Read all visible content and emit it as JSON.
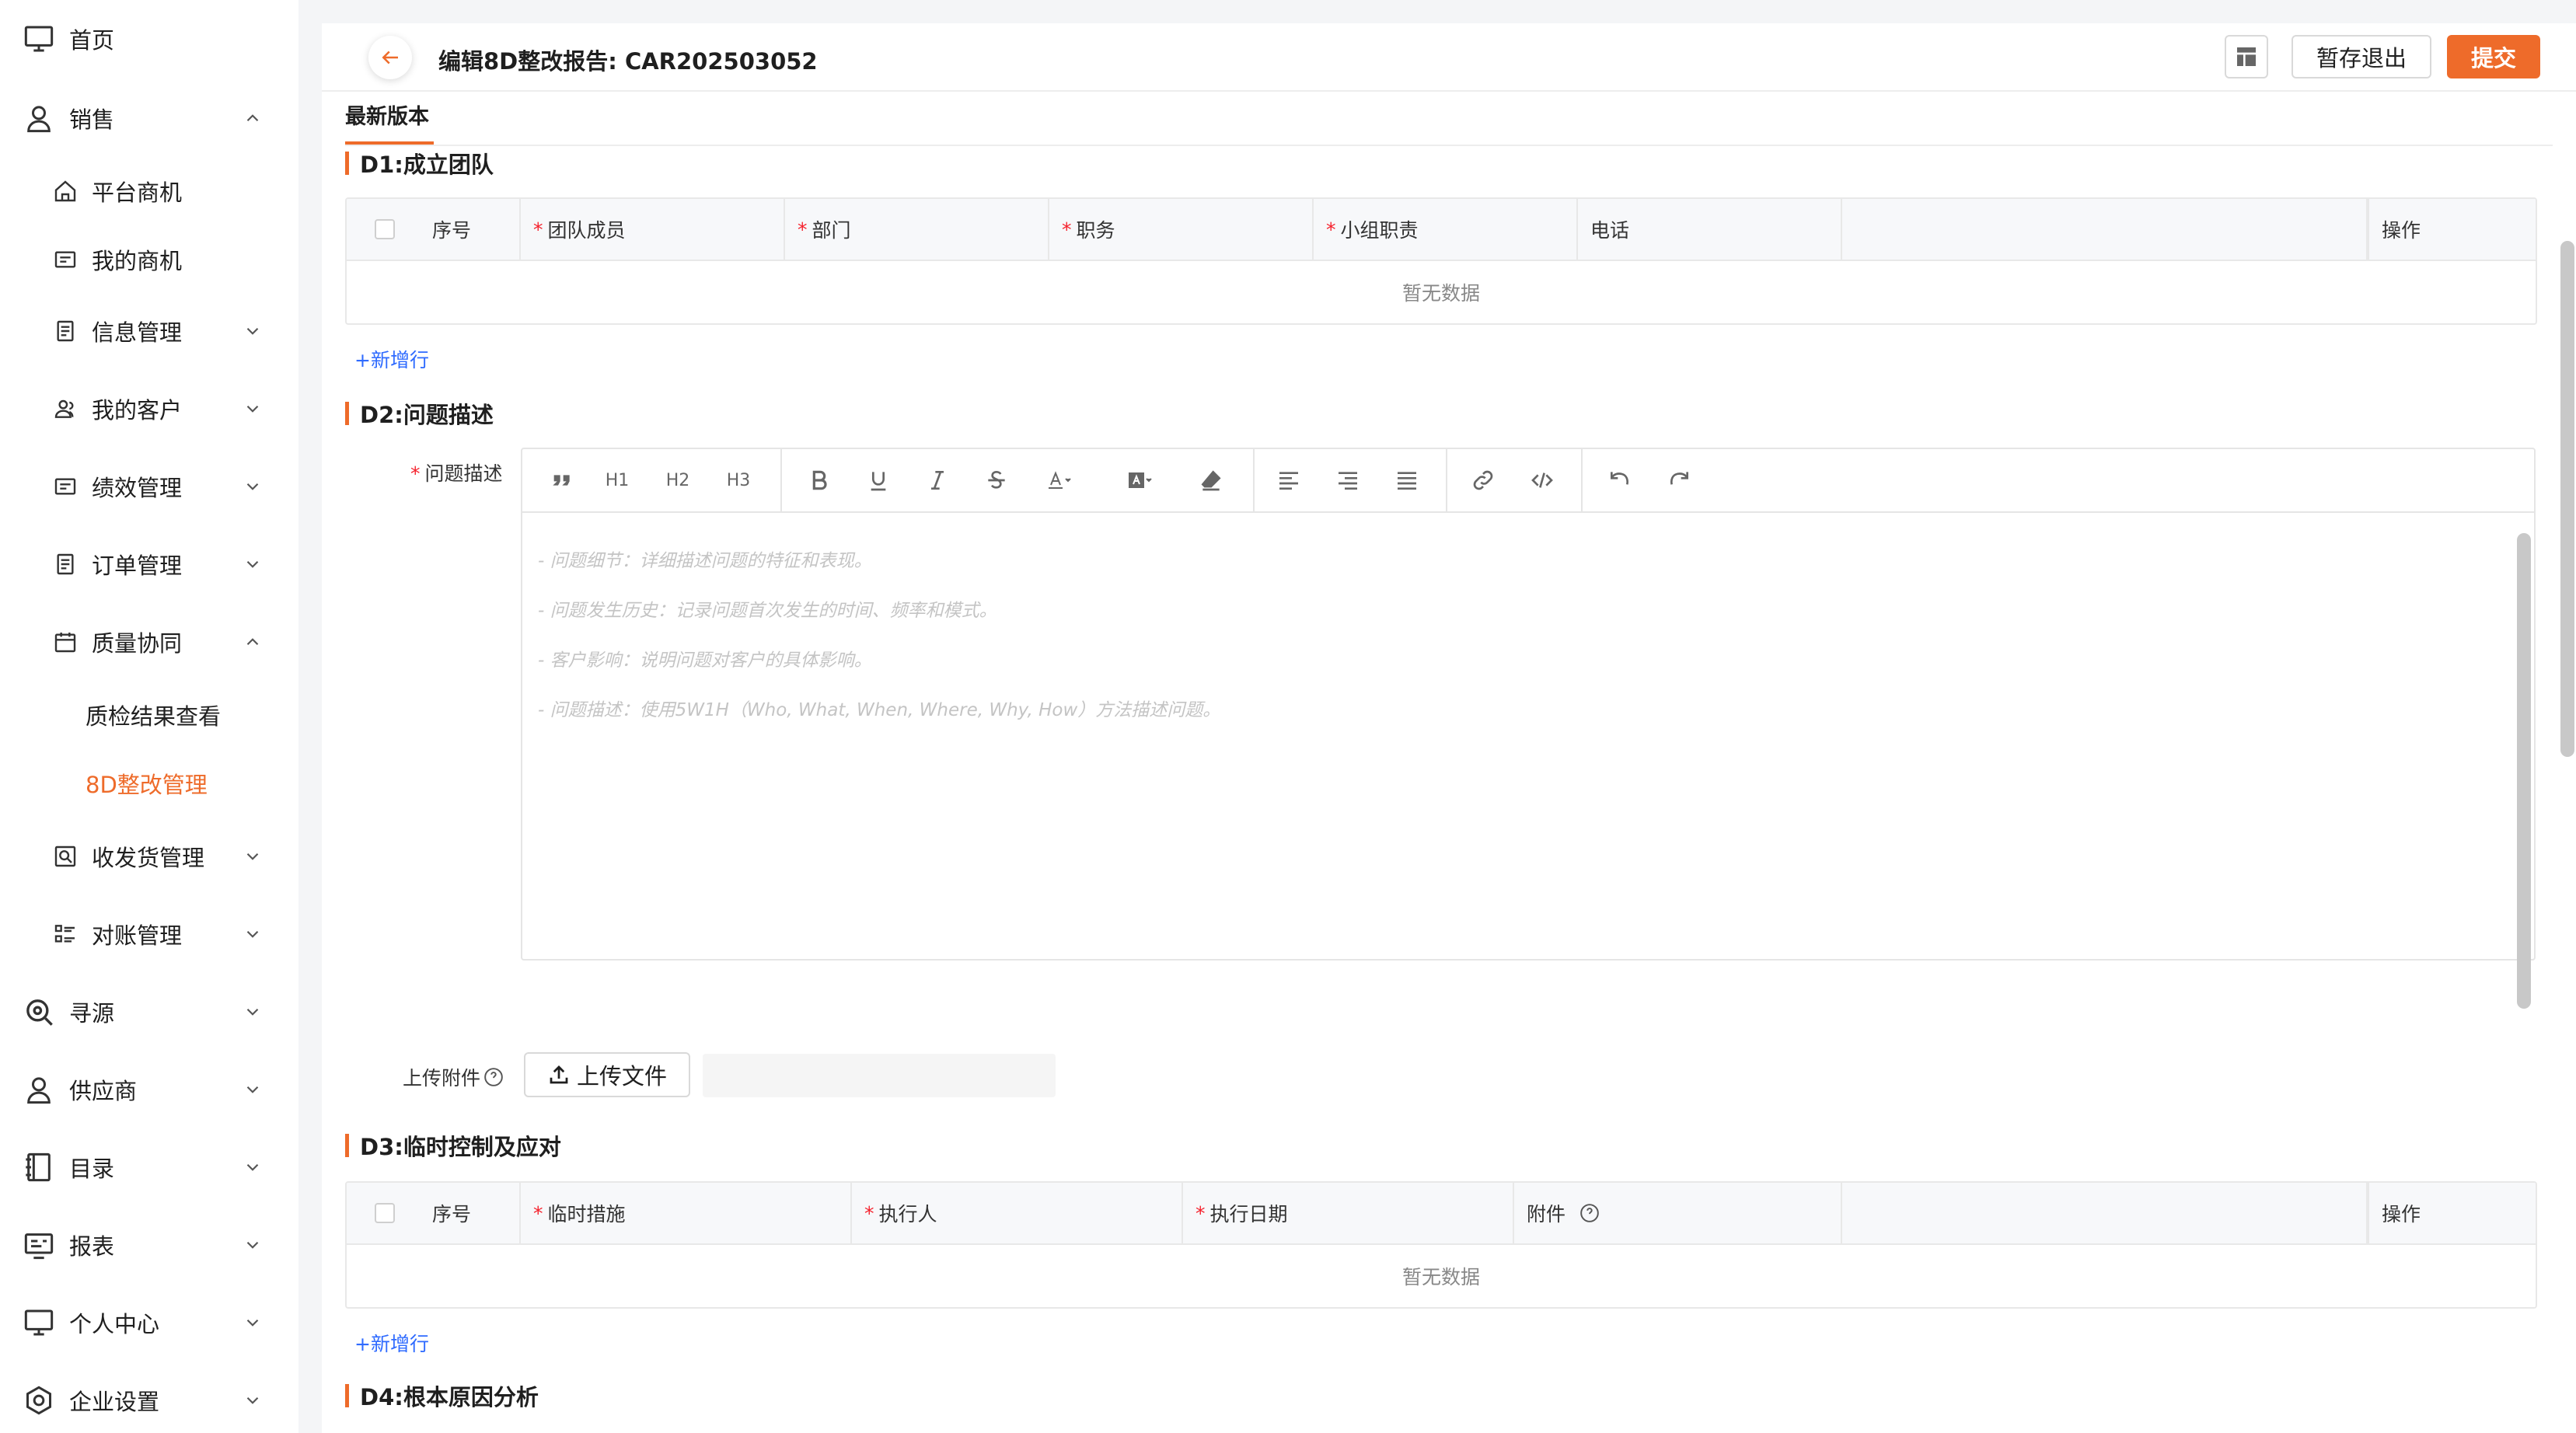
{
  "sidebar": {
    "items": [
      {
        "label": "首页",
        "icon": "monitor-icon",
        "expanded": null
      },
      {
        "label": "销售",
        "icon": "user-icon",
        "expanded": true
      },
      {
        "label": "平台商机",
        "icon": "home-icon"
      },
      {
        "label": "我的商机",
        "icon": "card-icon"
      },
      {
        "label": "信息管理",
        "icon": "document-icon",
        "expanded": false
      },
      {
        "label": "我的客户",
        "icon": "customers-icon",
        "expanded": false
      },
      {
        "label": "绩效管理",
        "icon": "card-icon",
        "expanded": false
      },
      {
        "label": "订单管理",
        "icon": "document-icon",
        "expanded": false
      },
      {
        "label": "质量协同",
        "icon": "calendar-icon",
        "expanded": true
      },
      {
        "label": "质检结果查看"
      },
      {
        "label": "8D整改管理",
        "active": true
      },
      {
        "label": "收发货管理",
        "icon": "shipping-icon",
        "expanded": false
      },
      {
        "label": "对账管理",
        "icon": "list-icon",
        "expanded": false
      },
      {
        "label": "寻源",
        "icon": "search-icon",
        "expanded": false
      },
      {
        "label": "供应商",
        "icon": "user-icon",
        "expanded": false
      },
      {
        "label": "目录",
        "icon": "book-icon",
        "expanded": false
      },
      {
        "label": "报表",
        "icon": "report-icon",
        "expanded": false
      },
      {
        "label": "个人中心",
        "icon": "monitor-icon",
        "expanded": false
      },
      {
        "label": "企业设置",
        "icon": "settings-icon",
        "expanded": false
      }
    ]
  },
  "header": {
    "title": "编辑8D整改报告: CAR202503052",
    "save_label": "暂存退出",
    "submit_label": "提交"
  },
  "tab": {
    "label": "最新版本"
  },
  "d1": {
    "title": "D1:成立团队",
    "columns": [
      {
        "label": "序号",
        "required": false
      },
      {
        "label": "团队成员",
        "required": true
      },
      {
        "label": "部门",
        "required": true
      },
      {
        "label": "职务",
        "required": true
      },
      {
        "label": "小组职责",
        "required": true
      },
      {
        "label": "电话",
        "required": false
      },
      {
        "label": "",
        "required": false
      },
      {
        "label": "操作",
        "required": false
      }
    ],
    "empty_text": "暂无数据",
    "add_row_label": "+新增行"
  },
  "d2": {
    "title": "D2:问题描述",
    "field_label": "问题描述",
    "toolbar": [
      "quote-icon",
      "H1",
      "H2",
      "H3",
      "bold-icon",
      "underline-icon",
      "italic-icon",
      "strikethrough-icon",
      "font-color-icon",
      "background-color-icon",
      "clear-format-icon",
      "align-left-icon",
      "align-right-icon",
      "align-justify-icon",
      "link-icon",
      "code-icon",
      "undo-icon",
      "redo-icon"
    ],
    "placeholder_lines": [
      "- 问题细节：详细描述问题的特征和表现。",
      "- 问题发生历史：记录问题首次发生的时间、频率和模式。",
      "- 客户影响：说明问题对客户的具体影响。",
      "- 问题描述：使用5W1H（Who, What, When, Where, Why, How）方法描述问题。"
    ],
    "upload_label": "上传附件",
    "upload_button": "上传文件"
  },
  "d3": {
    "title": "D3:临时控制及应对",
    "columns": [
      {
        "label": "序号",
        "required": false
      },
      {
        "label": "临时措施",
        "required": true
      },
      {
        "label": "执行人",
        "required": true
      },
      {
        "label": "执行日期",
        "required": true
      },
      {
        "label": "附件",
        "required": false
      },
      {
        "label": "",
        "required": false
      },
      {
        "label": "操作",
        "required": false
      }
    ],
    "empty_text": "暂无数据",
    "add_row_label": "+新增行"
  },
  "d4": {
    "title": "D4:根本原因分析"
  },
  "colors": {
    "accent": "#ee6b2a",
    "link": "#2f6bff",
    "required": "#f5222d"
  }
}
